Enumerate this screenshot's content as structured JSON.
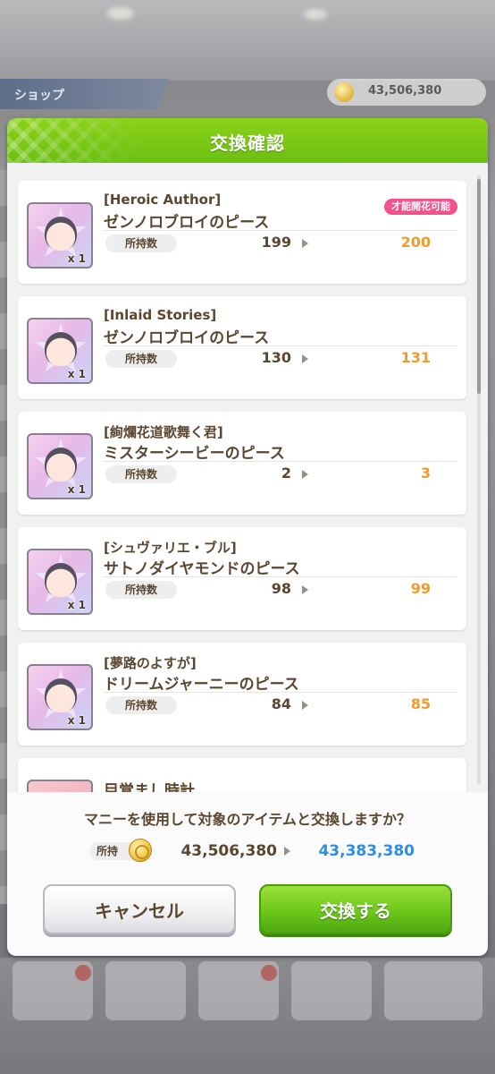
{
  "background": {
    "shop_label": "ショップ",
    "money": "43,506,380"
  },
  "dialog": {
    "title": "交換確認",
    "owned_label": "所持数",
    "items": [
      {
        "tag": "[Heroic Author]",
        "name": "ゼンノロブロイのピース",
        "qty": "x 1",
        "badge": "才能開花可能",
        "owned_from": "199",
        "owned_to": "200"
      },
      {
        "tag": "[Inlaid Stories]",
        "name": "ゼンノロブロイのピース",
        "qty": "x 1",
        "badge": "",
        "owned_from": "130",
        "owned_to": "131"
      },
      {
        "tag": "[絢爛花道歌舞く君]",
        "name": "ミスターシービーのピース",
        "qty": "x 1",
        "badge": "",
        "owned_from": "2",
        "owned_to": "3"
      },
      {
        "tag": "[シュヴァリエ・ブル]",
        "name": "サトノダイヤモンドのピース",
        "qty": "x 1",
        "badge": "",
        "owned_from": "98",
        "owned_to": "99"
      },
      {
        "tag": "[夢路のよすが]",
        "name": "ドリームジャーニーのピース",
        "qty": "x 1",
        "badge": "",
        "owned_from": "84",
        "owned_to": "85"
      },
      {
        "tag": "",
        "name": "目覚まし時計",
        "qty": "",
        "badge": "",
        "owned_from": "",
        "owned_to": ""
      }
    ],
    "confirm_text": "マニーを使用して対象のアイテムと交換しますか？",
    "money_label": "所持",
    "money_from": "43,506,380",
    "money_to": "43,383,380",
    "cancel_label": "キャンセル",
    "exchange_label": "交換する"
  },
  "colors": {
    "header_green": "#7ccb16",
    "text_brown": "#5b4630",
    "orange_value": "#f39a2b",
    "blue_value": "#2f8de0",
    "badge_pink": "#f2518c"
  }
}
